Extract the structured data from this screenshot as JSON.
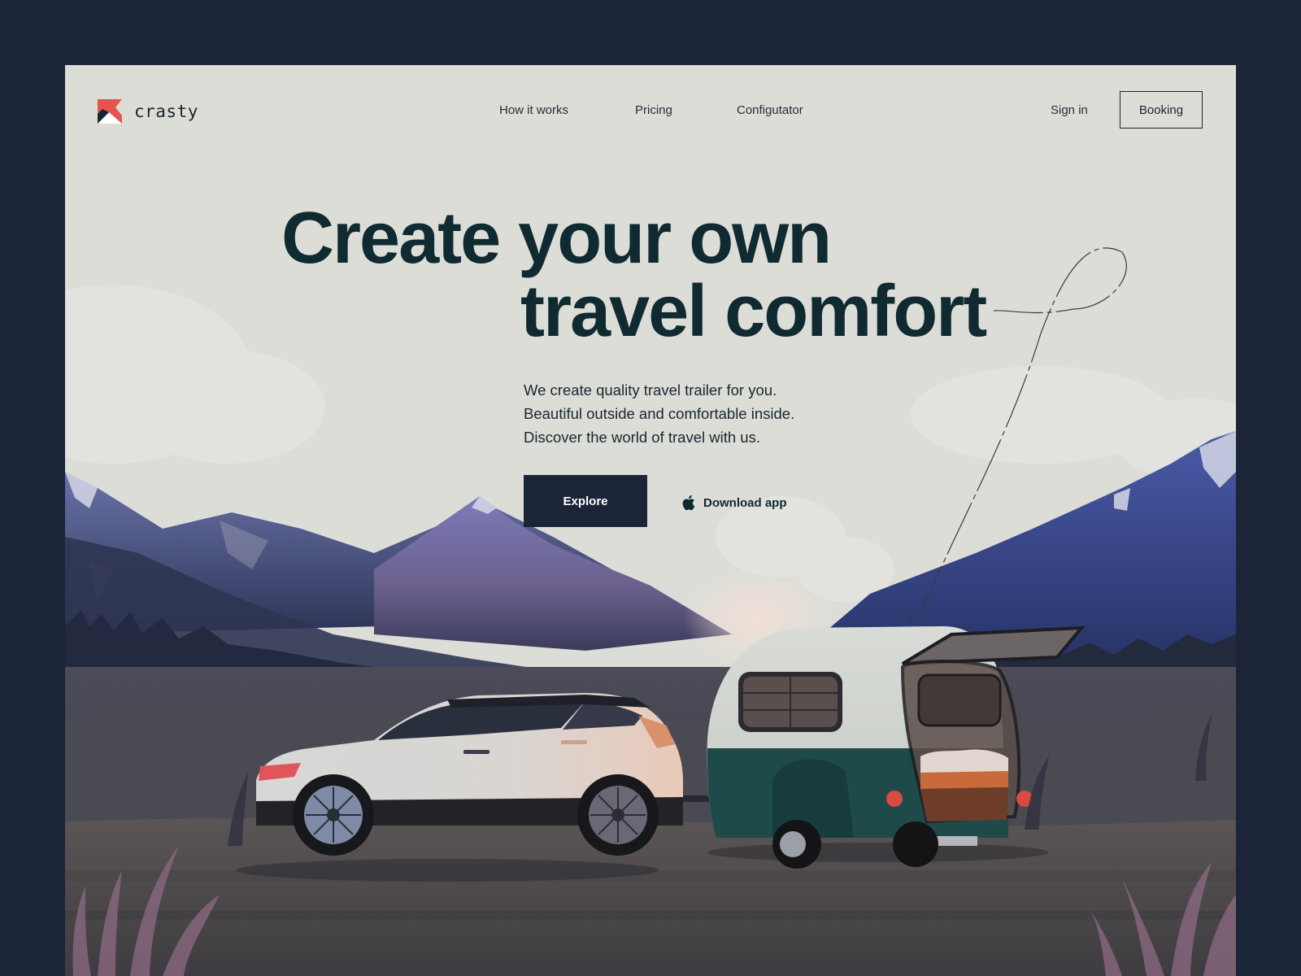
{
  "brand": {
    "name": "crasty",
    "logo_icon": "crasty-logo-icon",
    "accent": "#e5544f"
  },
  "nav": {
    "links": [
      {
        "label": "How it works"
      },
      {
        "label": "Pricing"
      },
      {
        "label": "Configutator"
      }
    ],
    "sign_in": "Sign in",
    "booking": "Booking"
  },
  "hero": {
    "title_line1": "Create your own",
    "title_line2": "travel comfort",
    "subtitle_lines": [
      "We create quality travel trailer for you.",
      "Beautiful outside and comfortable inside.",
      "Discover the world of travel with us."
    ],
    "primary_cta": "Explore",
    "secondary_cta": "Download app",
    "secondary_cta_icon": "apple-icon"
  },
  "colors": {
    "background": "#1c2438",
    "page": "#ddddd8",
    "heading": "#0f2a30",
    "button": "#1c2438"
  }
}
